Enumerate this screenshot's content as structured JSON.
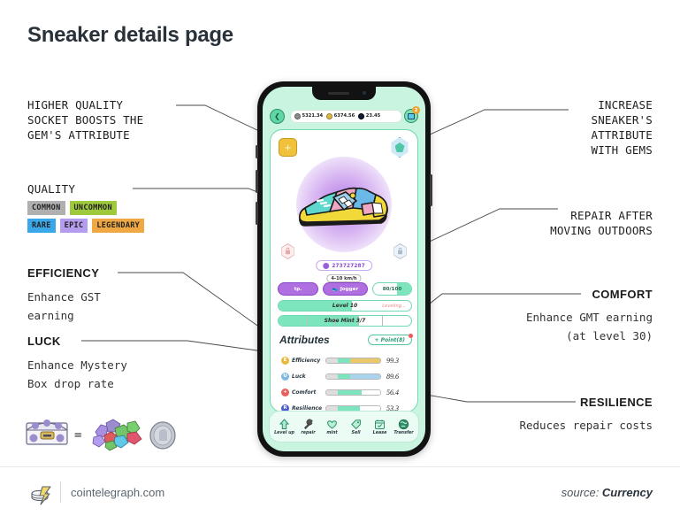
{
  "page": {
    "title": "Sneaker details page"
  },
  "annotations": {
    "socket": {
      "lines": [
        "HIGHER QUALITY",
        "SOCKET BOOSTS THE",
        "GEM'S ATTRIBUTE"
      ]
    },
    "quality": {
      "label": "QUALITY"
    },
    "efficiency": {
      "heading": "EFFICIENCY",
      "lines": [
        "Enhance GST",
        "earning"
      ]
    },
    "luck": {
      "heading": "LUCK",
      "lines": [
        "Enhance Mystery",
        "Box drop rate"
      ]
    },
    "gems": {
      "heading": "INCREASE",
      "lines": [
        "INCREASE",
        "SNEAKER'S",
        "ATTRIBUTE",
        "WITH GEMS"
      ]
    },
    "repair": {
      "lines": [
        "REPAIR AFTER",
        "MOVING OUTDOORS"
      ]
    },
    "comfort": {
      "heading": "COMFORT",
      "lines": [
        "Enhance GMT earning",
        "(at level 30)"
      ]
    },
    "resilience": {
      "heading": "RESILIENCE",
      "lines": [
        "Reduces repair costs"
      ]
    }
  },
  "quality_badges": [
    {
      "label": "COMMON",
      "bg": "#b0b0b0",
      "fg": "#1f1f1f"
    },
    {
      "label": "UNCOMMON",
      "bg": "#9fc93c",
      "fg": "#1f1f1f"
    },
    {
      "label": "RARE",
      "bg": "#3aa7e8",
      "fg": "#1f1f1f"
    },
    {
      "label": "EPIC",
      "bg": "#b49cee",
      "fg": "#1f1f1f"
    },
    {
      "label": "LEGENDARY",
      "bg": "#efa843",
      "fg": "#1f1f1f"
    }
  ],
  "phone": {
    "status": {
      "back_icon": "chevron-left-icon",
      "balances": [
        {
          "coin": "gray-coin",
          "value": "5321.34"
        },
        {
          "coin": "gold-coin",
          "value": "6374.56"
        },
        {
          "coin": "dark-coin",
          "value": "23.45"
        }
      ],
      "wallet_badge": "2"
    },
    "card": {
      "socket_top_left": "+",
      "socket_top_right": "gem-icon",
      "lock_left": "lock-icon",
      "lock_right": "lock-icon",
      "shoe_id": "273727287",
      "speed_tag": "4-10 km/h",
      "pill_type": "tp.",
      "pill_class": "Jogger",
      "pill_durability": "80/100",
      "level_bar": {
        "label": "Level 10",
        "status": "Leveling...",
        "fill_pct": 55
      },
      "mint_bar": {
        "label": "Shoe Mint 3/7",
        "fill_pct": 60,
        "segments": 7
      },
      "attributes_title": "Attributes",
      "point_button": "+ Point(8)",
      "attributes": [
        {
          "icon": "E",
          "icon_color": "#e8b93c",
          "label": "Efficiency",
          "value": "99.3",
          "gray_pct": 22,
          "green_pct": 22,
          "accent_pct": 56,
          "accent_color": "#e8c86a"
        },
        {
          "icon": "U",
          "icon_color": "#7fb8e0",
          "label": "Luck",
          "value": "89.6",
          "gray_pct": 22,
          "green_pct": 22,
          "accent_pct": 56,
          "accent_color": "#a9d4ee"
        },
        {
          "icon": "+",
          "icon_color": "#e8605f",
          "label": "Comfort",
          "value": "56.4",
          "gray_pct": 22,
          "green_pct": 44,
          "accent_pct": 0,
          "accent_color": "#7de5bd"
        },
        {
          "icon": "R",
          "icon_color": "#4a5bd0",
          "label": "Resilience",
          "value": "53.3",
          "gray_pct": 22,
          "green_pct": 40,
          "accent_pct": 0,
          "accent_color": "#7de5bd"
        }
      ]
    },
    "nav": [
      {
        "icon": "arrow-up-icon",
        "label": "Level up"
      },
      {
        "icon": "wrench-icon",
        "label": "repair"
      },
      {
        "icon": "heart-icon",
        "label": "mint"
      },
      {
        "icon": "tag-icon",
        "label": "Sell"
      },
      {
        "icon": "calendar-icon",
        "label": "Lease"
      },
      {
        "icon": "globe-icon",
        "label": "Transfer"
      }
    ]
  },
  "footer": {
    "logo": "cointelegraph-logo",
    "url": "cointelegraph.com",
    "source_prefix": "source: ",
    "source_name": "Currency"
  },
  "colors": {
    "title": "#29313a",
    "screen_bg": "#c8f4e0",
    "accent_green": "#7de5bd",
    "accent_purple": "#b06fe0"
  }
}
